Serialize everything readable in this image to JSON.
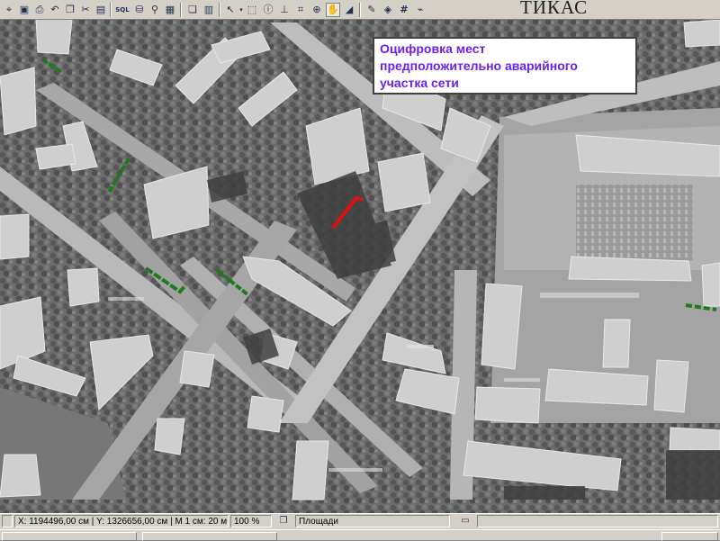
{
  "toolbar": {
    "title": "ТИКАС",
    "buttons": [
      {
        "icon": "pointer-icon",
        "glyph": "⌖"
      },
      {
        "icon": "save-icon",
        "glyph": "▣"
      },
      {
        "icon": "print-icon",
        "glyph": "⎙"
      },
      {
        "icon": "undo-icon",
        "glyph": "↶"
      },
      {
        "icon": "copy-icon",
        "glyph": "❐"
      },
      {
        "icon": "cut-icon",
        "glyph": "✂"
      },
      {
        "icon": "paste-icon",
        "glyph": "▤"
      },
      {
        "icon": "sql-icon",
        "glyph": "SQL"
      },
      {
        "icon": "database-icon",
        "glyph": "⛁"
      },
      {
        "icon": "query-icon",
        "glyph": "⚲"
      },
      {
        "icon": "report-icon",
        "glyph": "▦"
      },
      {
        "icon": "windows-icon",
        "glyph": "❏"
      },
      {
        "icon": "table-icon",
        "glyph": "▥"
      },
      {
        "icon": "select-arrow-icon",
        "glyph": "↖"
      },
      {
        "icon": "select-region-icon",
        "glyph": "⬚"
      },
      {
        "icon": "info-icon",
        "glyph": "ⓘ"
      },
      {
        "icon": "measure-icon",
        "glyph": "⊥"
      },
      {
        "icon": "label-icon",
        "glyph": "⌗"
      },
      {
        "icon": "zoom-icon",
        "glyph": "⊕"
      },
      {
        "icon": "pan-hand-icon",
        "glyph": "✋"
      },
      {
        "icon": "profile-icon",
        "glyph": "◢"
      },
      {
        "icon": "draw-icon",
        "glyph": "✎"
      },
      {
        "icon": "layers-icon",
        "glyph": "◈"
      },
      {
        "icon": "grid-icon",
        "glyph": "#"
      },
      {
        "icon": "brush-icon",
        "glyph": "⌁"
      }
    ]
  },
  "annotation": {
    "text": "Оцифровка мест\nпредположительно аварийного\nучастка сети"
  },
  "status": {
    "coordinates": "X: 1194496,00 см | Y: 1326656,00 см | М 1 см: 20 м",
    "zoom": "100 %",
    "layer": "Площади"
  },
  "colors": {
    "annotation_text": "#6a1ff0",
    "pipe_normal": "#1f7a1f",
    "pipe_emergency": "#e01010"
  }
}
